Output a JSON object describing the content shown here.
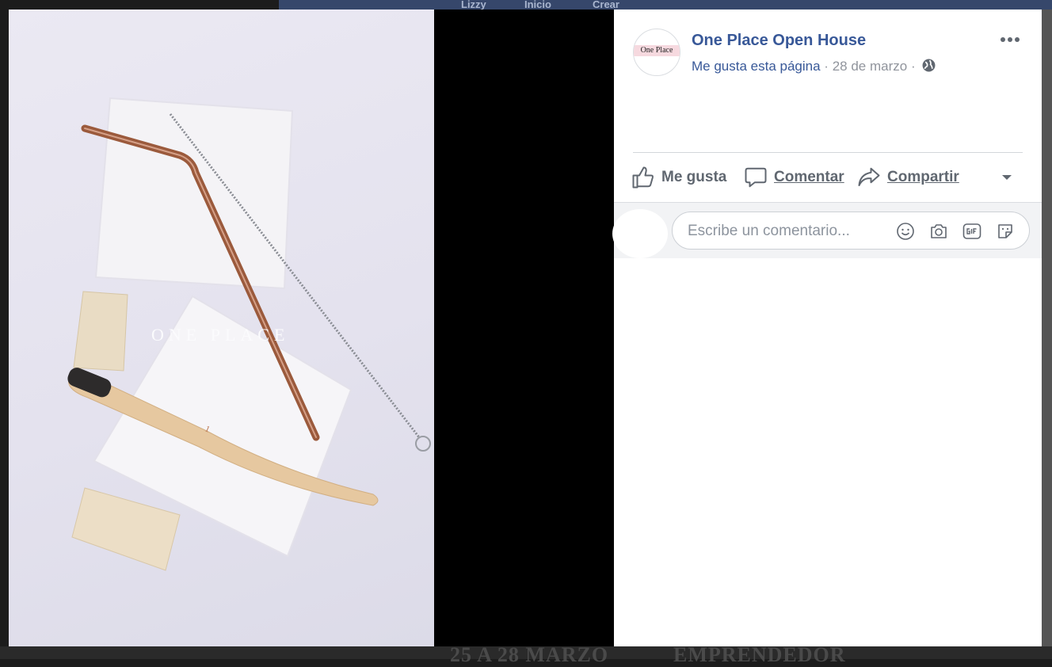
{
  "background": {
    "nav_items": [
      "Lizzy",
      "Inicio",
      "Crear"
    ],
    "bottom_text_left": "25 A 28 MARZO",
    "bottom_text_right": "EMPRENDEDOR"
  },
  "photo": {
    "caption": "ONE PLACE",
    "toothbrush_mark": "1"
  },
  "post": {
    "avatar_text": "One Place",
    "page_name": "One Place Open House",
    "like_page": "Me gusta esta página",
    "separator": "·",
    "date": "28 de marzo",
    "privacy_icon": "globe-icon",
    "more_icon": "more-options-icon"
  },
  "actions": {
    "like": "Me gusta",
    "comment": "Comentar",
    "share": "Compartir"
  },
  "comment_box": {
    "placeholder": "Escribe un comentario...",
    "icons": [
      "emoji-icon",
      "camera-icon",
      "gif-icon",
      "sticker-icon"
    ]
  },
  "colors": {
    "link": "#385898",
    "secondary": "#606770",
    "muted": "#90949c"
  }
}
